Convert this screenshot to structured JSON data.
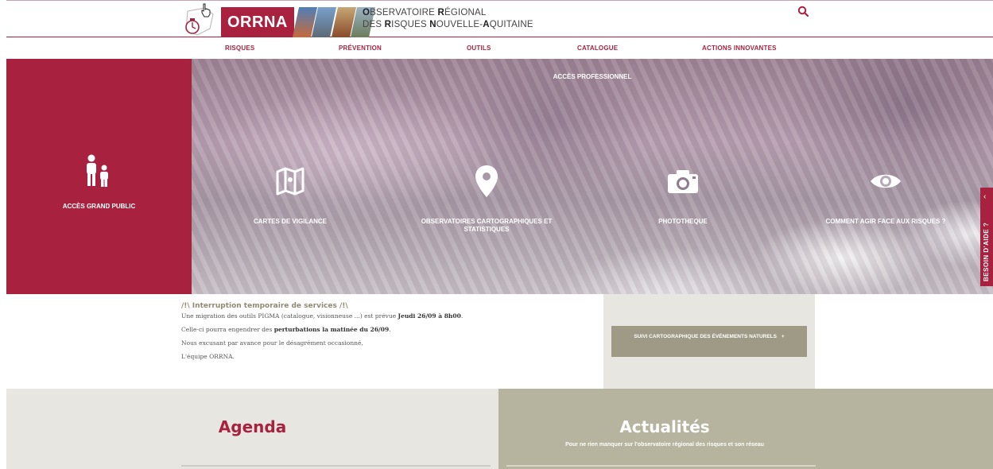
{
  "header": {
    "logo_text": "ORRNA",
    "title_line1": [
      {
        "cap": "O",
        "rest": "BSERVATOIRE "
      },
      {
        "cap": "R",
        "rest": "ÉGIONAL"
      }
    ],
    "title_line2": [
      {
        "cap": "",
        "rest": "DES "
      },
      {
        "cap": "R",
        "rest": "ISQUES "
      },
      {
        "cap": "N",
        "rest": "OUVELLE-"
      },
      {
        "cap": "A",
        "rest": "QUITAINE"
      }
    ]
  },
  "nav": {
    "items": [
      "RISQUES",
      "PRÉVENTION",
      "OUTILS",
      "CATALOGUE",
      "ACTIONS INNOVANTES"
    ]
  },
  "hero": {
    "public_label": "ACCÈS GRAND PUBLIC",
    "pro_label": "ACCÈS PROFESSIONNEL",
    "tiles": [
      {
        "label": "CARTES DE VIGILANCE",
        "icon": "map-icon"
      },
      {
        "label": "OBSERVATOIRES CARTOGRAPHIQUES ET STATISTIQUES",
        "icon": "location-pin-icon"
      },
      {
        "label": "PHOTOTHEQUE",
        "icon": "camera-icon"
      },
      {
        "label": "COMMENT AGIR FACE AUX RISQUES ?",
        "icon": "eye-icon"
      }
    ]
  },
  "help_tab": {
    "label": "BESOIN D'AIDE ?"
  },
  "notice": {
    "heading": "/!\\ Interruption temporaire de services /!\\",
    "line1_pre": "Une migration des outils PIGMA (catalogue, visionneuse ...) est prévue ",
    "line1_bold": "Jeudi 26/09 à 8h00",
    "line1_post": ".",
    "line2_pre": "Celle-ci pourra engendrer des ",
    "line2_bold": "perturbations la matinée du 26/09",
    "line2_post": ".",
    "line3": "Nous excusant par avance pour le désagrément occasionné,",
    "line4": "L'équipe ORRNA."
  },
  "suivi": {
    "label": "SUIVI CARTOGRAPHIQUE DES ÉVÉNEMENTS NATURELS",
    "plus": "+"
  },
  "agenda": {
    "title": "Agenda"
  },
  "actus": {
    "title": "Actualités",
    "subtitle": "Pour ne rien manquer sur l'observatoire régional des risques et son réseau"
  },
  "colors": {
    "brand": "#a8223f",
    "panel_light": "#e8e6e0",
    "panel_olive": "#b6b39e",
    "button_grey": "#9e9a86"
  }
}
